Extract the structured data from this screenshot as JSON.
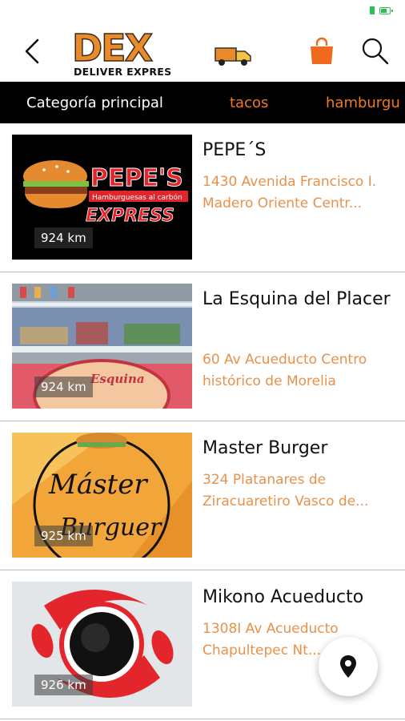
{
  "header": {
    "logo_text": "DEX",
    "logo_subtitle": "DELIVER EXPRES"
  },
  "icons": {
    "back": "chevron-left-icon",
    "bag": "shopping-bag-icon",
    "search": "search-icon",
    "location": "location-pin-icon"
  },
  "colors": {
    "accent": "#ef7a22",
    "category_bar": "#000000",
    "address": "#e8914a"
  },
  "categories": {
    "main": "Categoría principal",
    "items": [
      "tacos",
      "hamburgu"
    ]
  },
  "restaurants": [
    {
      "name": "PEPE´S",
      "address": "1430 Avenida Francisco I. Madero Oriente Centr...",
      "distance": "924 km",
      "logo_text": "PEPE'S",
      "logo_tagline": "Hamburguesas al carbón",
      "logo_sub": "EXPRESS"
    },
    {
      "name": "La Esquina del Placer",
      "address": "60 Av Acueducto Centro histórico de Morelia",
      "distance": "924 km",
      "logo_text": "Esquina"
    },
    {
      "name": "Master Burger",
      "address": "324 Platanares de Ziracuaretiro Vasco de...",
      "distance": "925 km",
      "logo_text": "Máster",
      "logo_sub": "Burguer"
    },
    {
      "name": "Mikono Acueducto",
      "address": "1308I Av Acueducto Chapultepec Nt...",
      "distance": "926 km"
    }
  ]
}
